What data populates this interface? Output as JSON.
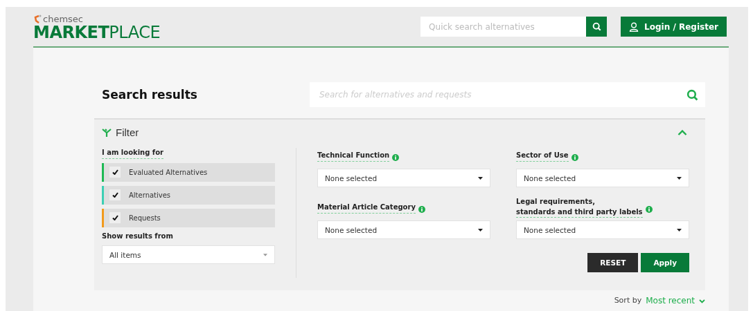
{
  "header": {
    "logo_small": "chemsec",
    "logo_bold": "MARKET",
    "logo_light": "PLACE",
    "quick_search": {
      "placeholder": "Quick search alternatives"
    },
    "login_button": "Login / Register"
  },
  "search": {
    "title": "Search results",
    "placeholder": "Search for alternatives and requests"
  },
  "filter": {
    "title": "Filter",
    "expanded": true,
    "looking_for": {
      "label": "I am looking for",
      "options": [
        {
          "label": "Evaluated Alternatives",
          "checked": true,
          "color": "#1db954"
        },
        {
          "label": "Alternatives",
          "checked": true,
          "color": "#3ccfb4"
        },
        {
          "label": "Requests",
          "checked": true,
          "color": "#f29a1c"
        }
      ]
    },
    "show_results_from": {
      "label": "Show results from",
      "value": "All items"
    },
    "dropdowns": [
      {
        "label": "Technical Function",
        "value": "None selected"
      },
      {
        "label": "Material Article Category",
        "value": "None selected"
      },
      {
        "label": "Sector of Use",
        "value": "None selected"
      },
      {
        "label": "Legal requirements,\nstandards and third party labels",
        "value": "None selected"
      }
    ],
    "buttons": [
      {
        "label": "RESET",
        "kind": "secondary"
      },
      {
        "label": "Apply",
        "kind": "primary"
      }
    ]
  },
  "sort": {
    "label": "Sort by",
    "value": "Most recent"
  }
}
